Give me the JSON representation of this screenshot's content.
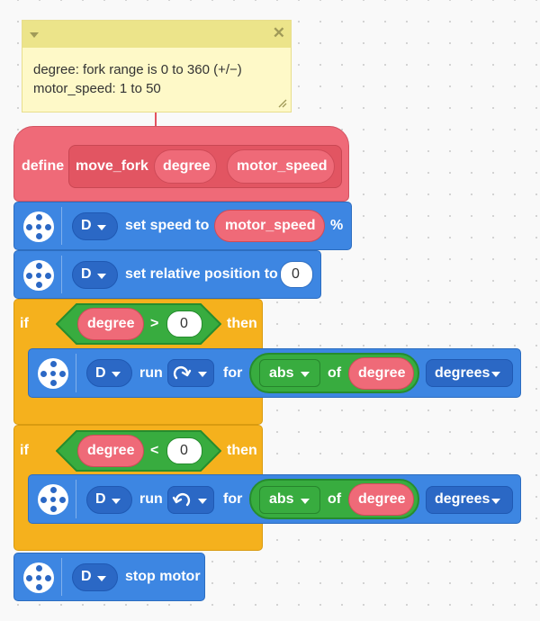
{
  "comment": {
    "line1": "degree: fork range is 0 to 360 (+/−)",
    "line2": "motor_speed: 1 to 50",
    "collapse_icon": "triangle-down-icon",
    "close_icon": "x-icon"
  },
  "define_block": {
    "keyword": "define",
    "name": "move_fork",
    "param1": "degree",
    "param2": "motor_speed"
  },
  "block_set_speed": {
    "motor": "D",
    "text": "set speed to",
    "value": "motor_speed",
    "unit": "%"
  },
  "block_set_position": {
    "motor": "D",
    "text": "set relative position to",
    "value": "0"
  },
  "if1": {
    "keyword": "if",
    "left": "degree",
    "operator": ">",
    "right": "0",
    "then": "then",
    "run": {
      "motor": "D",
      "run": "run",
      "direction_icon": "clockwise-arrow-icon",
      "for": "for",
      "func": "abs",
      "of": "of",
      "arg": "degree",
      "unit": "degrees"
    }
  },
  "if2": {
    "keyword": "if",
    "left": "degree",
    "operator": "<",
    "right": "0",
    "then": "then",
    "run": {
      "motor": "D",
      "run": "run",
      "direction_icon": "counterclockwise-arrow-icon",
      "for": "for",
      "func": "abs",
      "of": "of",
      "arg": "degree",
      "unit": "degrees"
    }
  },
  "block_stop": {
    "motor": "D",
    "text": "stop motor"
  },
  "colors": {
    "define": "#ef6a78",
    "motor": "#3d86e2",
    "control": "#f5b11d",
    "operator": "#38ac3f",
    "comment": "#fef9c8"
  }
}
